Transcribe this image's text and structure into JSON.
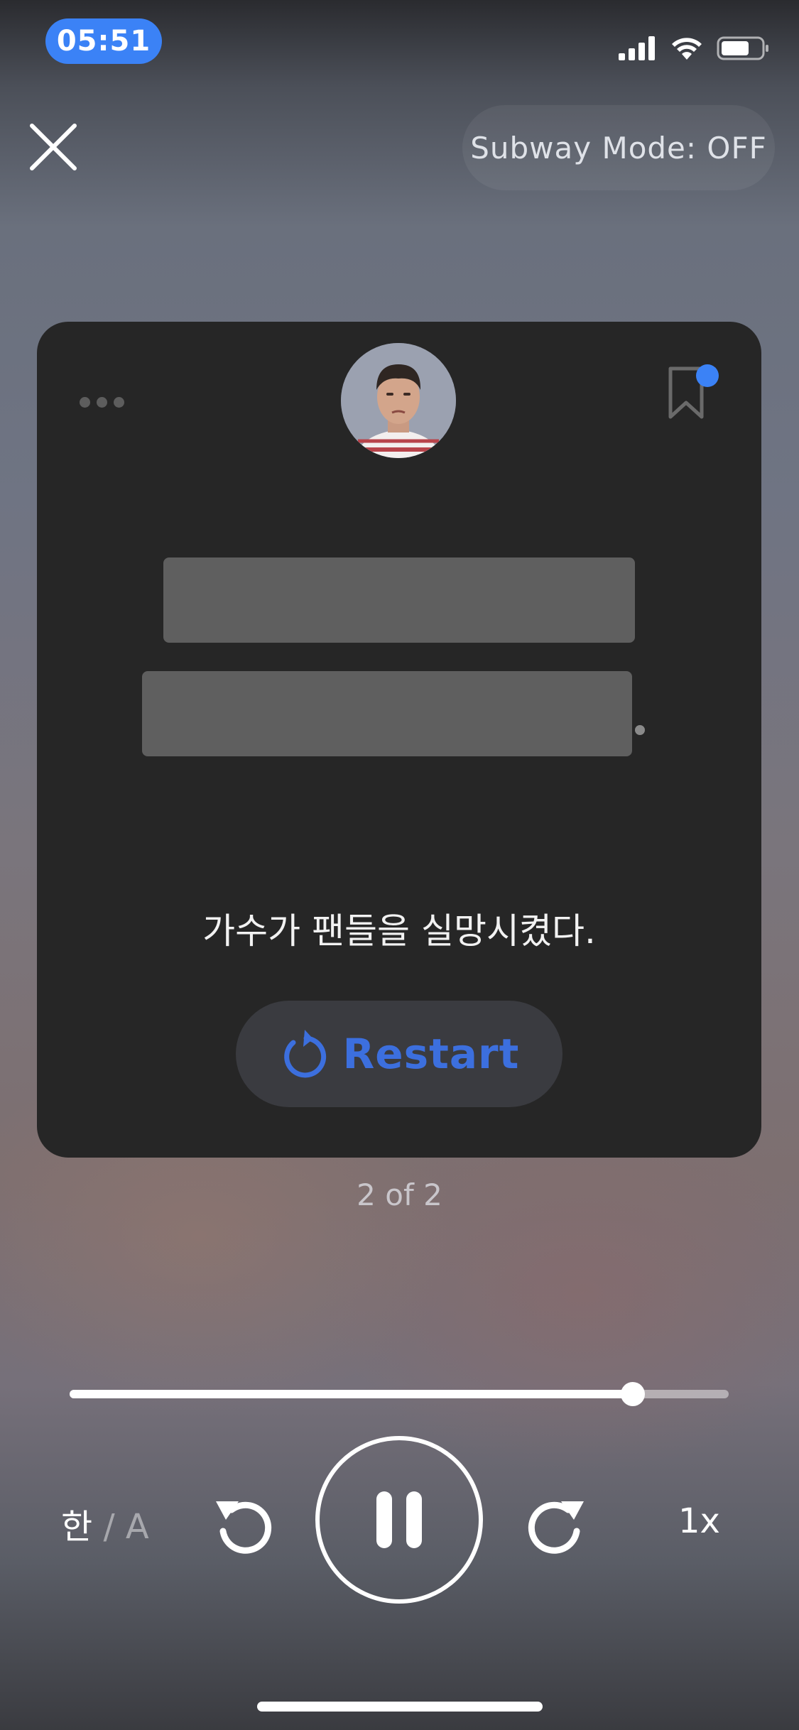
{
  "status_bar": {
    "time": "05:51",
    "icons": [
      "cellular-signal-icon",
      "wifi-icon",
      "battery-icon"
    ]
  },
  "top_bar": {
    "close_icon": "close-icon",
    "subway_mode_label": "Subway Mode: OFF"
  },
  "card": {
    "more_icon": "more-dots-icon",
    "bookmark_icon": "bookmark-icon",
    "translation": "가수가 팬들을 실망시켰다.",
    "restart_label": "Restart",
    "restart_icon": "restart-icon"
  },
  "counter": "2 of 2",
  "player": {
    "progress": 0.855,
    "lang_toggle": {
      "primary": "한",
      "separator": "/",
      "secondary": "A"
    },
    "speed": "1x"
  },
  "colors": {
    "accent": "#3b82f6",
    "restart_text": "#3c6fde",
    "card_bg": "#262626",
    "blank_fill": "#5f5f5f"
  }
}
